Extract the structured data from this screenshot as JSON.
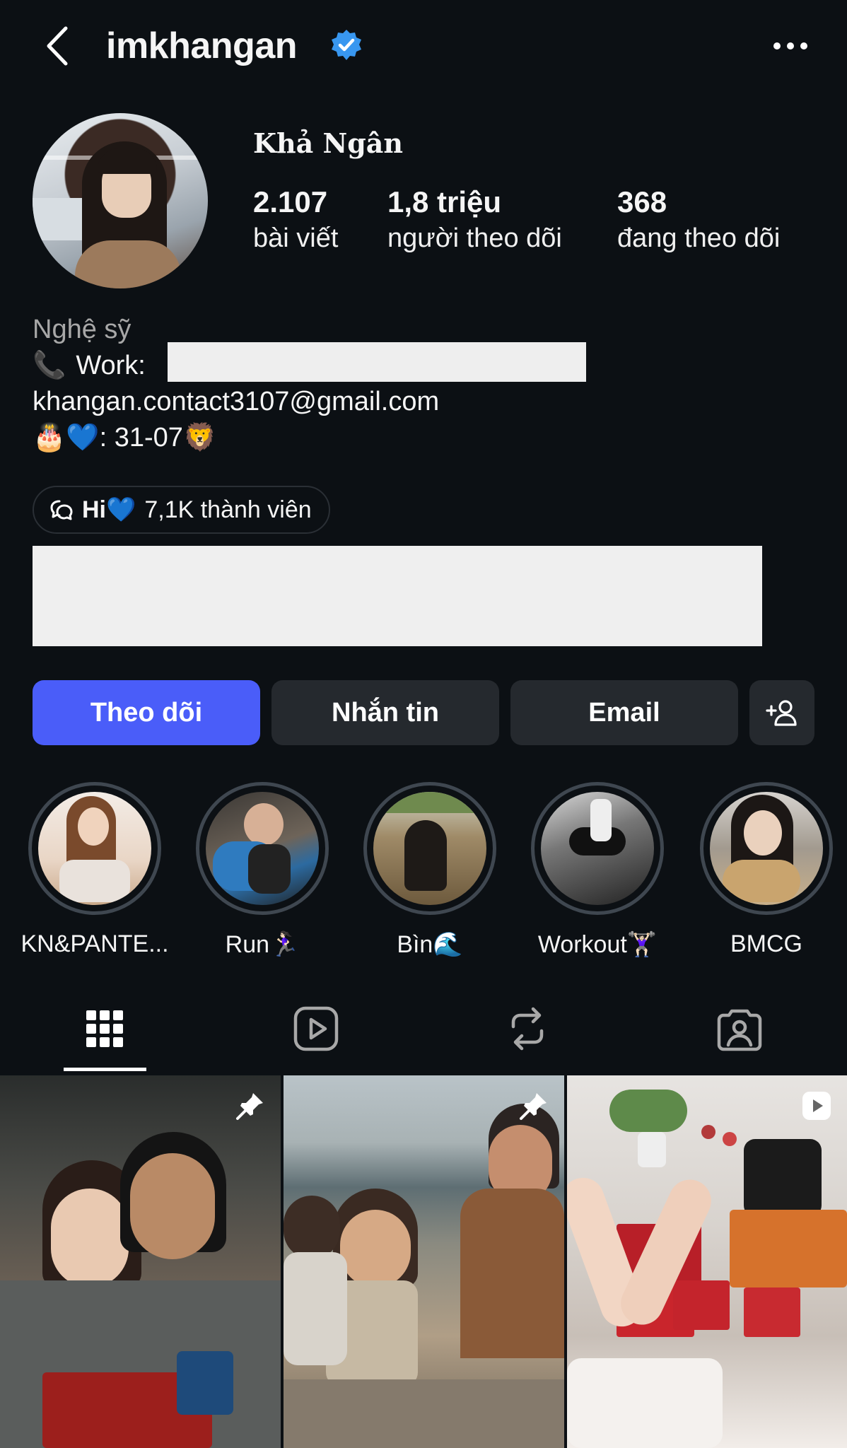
{
  "header": {
    "username": "imkhangan",
    "verified": true
  },
  "profile": {
    "display_name": "Khả Ngân",
    "stats": {
      "posts_value": "2.107",
      "posts_label": "bài viết",
      "followers_value": "1,8 triệu",
      "followers_label": "người theo dõi",
      "following_value": "368",
      "following_label": "đang theo dõi"
    }
  },
  "bio": {
    "category": "Nghệ sỹ",
    "work_emoji": "📞",
    "work_label": "Work:",
    "email": "khangan.contact3107@gmail.com",
    "birthday_emoji": "🎂💙",
    "birthday_text": ": 31-07",
    "birthday_suffix_emoji": "🦁"
  },
  "community": {
    "name": "Hi",
    "emoji": "💙",
    "members": "7,1K thành viên"
  },
  "buttons": {
    "follow": "Theo dõi",
    "message": "Nhắn tin",
    "email": "Email"
  },
  "highlights": [
    {
      "label": "KN&PANTE..."
    },
    {
      "label": "Run🏃🏻‍♀️"
    },
    {
      "label": "Bìn🌊"
    },
    {
      "label": "Workout🏋🏻‍♀️"
    },
    {
      "label": "BMCG"
    }
  ],
  "tabs": [
    {
      "icon": "grid-icon",
      "active": true
    },
    {
      "icon": "reels-icon",
      "active": false
    },
    {
      "icon": "reposts-icon",
      "active": false
    },
    {
      "icon": "tagged-icon",
      "active": false
    }
  ],
  "posts": [
    {
      "badge": "pin-icon"
    },
    {
      "badge": "pin-icon"
    },
    {
      "badge": "reel-icon"
    }
  ],
  "colors": {
    "background": "#0c1014",
    "accent": "#4a5df9",
    "verified": "#3897f0",
    "secondary_button": "#25292e"
  }
}
